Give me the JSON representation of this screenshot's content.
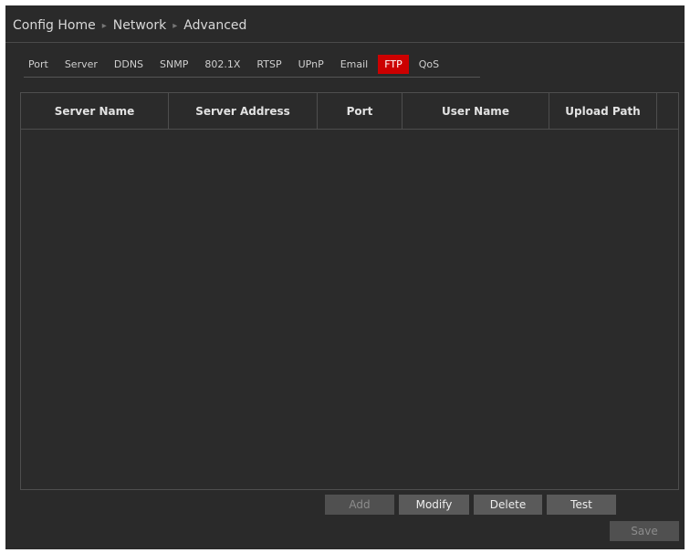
{
  "breadcrumb": {
    "home": "Config Home",
    "section": "Network",
    "page": "Advanced"
  },
  "tabs": [
    {
      "label": "Port",
      "active": false
    },
    {
      "label": "Server",
      "active": false
    },
    {
      "label": "DDNS",
      "active": false
    },
    {
      "label": "SNMP",
      "active": false
    },
    {
      "label": "802.1X",
      "active": false
    },
    {
      "label": "RTSP",
      "active": false
    },
    {
      "label": "UPnP",
      "active": false
    },
    {
      "label": "Email",
      "active": false
    },
    {
      "label": "FTP",
      "active": true
    },
    {
      "label": "QoS",
      "active": false
    }
  ],
  "table": {
    "columns": [
      "Server Name",
      "Server Address",
      "Port",
      "User Name",
      "Upload Path"
    ],
    "rows": []
  },
  "buttons": {
    "add": "Add",
    "modify": "Modify",
    "delete": "Delete",
    "test": "Test",
    "save": "Save"
  },
  "colors": {
    "background": "#2a2a2a",
    "active_tab": "#cc0000",
    "button": "#5a5a5a"
  }
}
